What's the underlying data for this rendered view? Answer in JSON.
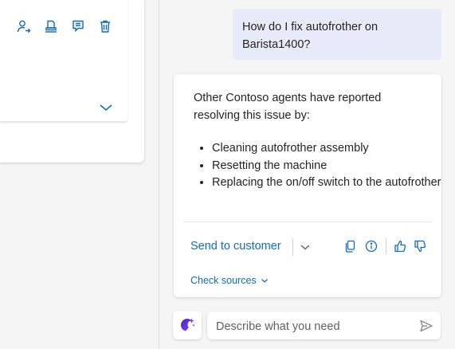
{
  "left_panel": {
    "toolbar_icons": [
      "assign-user-icon",
      "escalate-icon",
      "notes-icon",
      "delete-icon"
    ],
    "expand_icon": "chevron-down-icon"
  },
  "chat": {
    "user_message": "How do I fix autofrother on Barista1400?",
    "assistant": {
      "intro": "Other Contoso agents have reported resolving this issue by:",
      "steps": [
        "Cleaning autofrother assembly",
        "Resetting the machine",
        "Replacing the on/off switch to the autofrother"
      ],
      "send_label": "Send to customer",
      "check_sources_label": "Check sources",
      "action_icons": [
        "copy-icon",
        "info-icon",
        "thumbs-up-icon",
        "thumbs-down-icon"
      ]
    }
  },
  "composer": {
    "placeholder": "Describe what you need"
  },
  "colors": {
    "accent": "#0f6cbd",
    "user_bubble": "#e8ebfa",
    "copilot_icon": "#5b2fd6"
  }
}
